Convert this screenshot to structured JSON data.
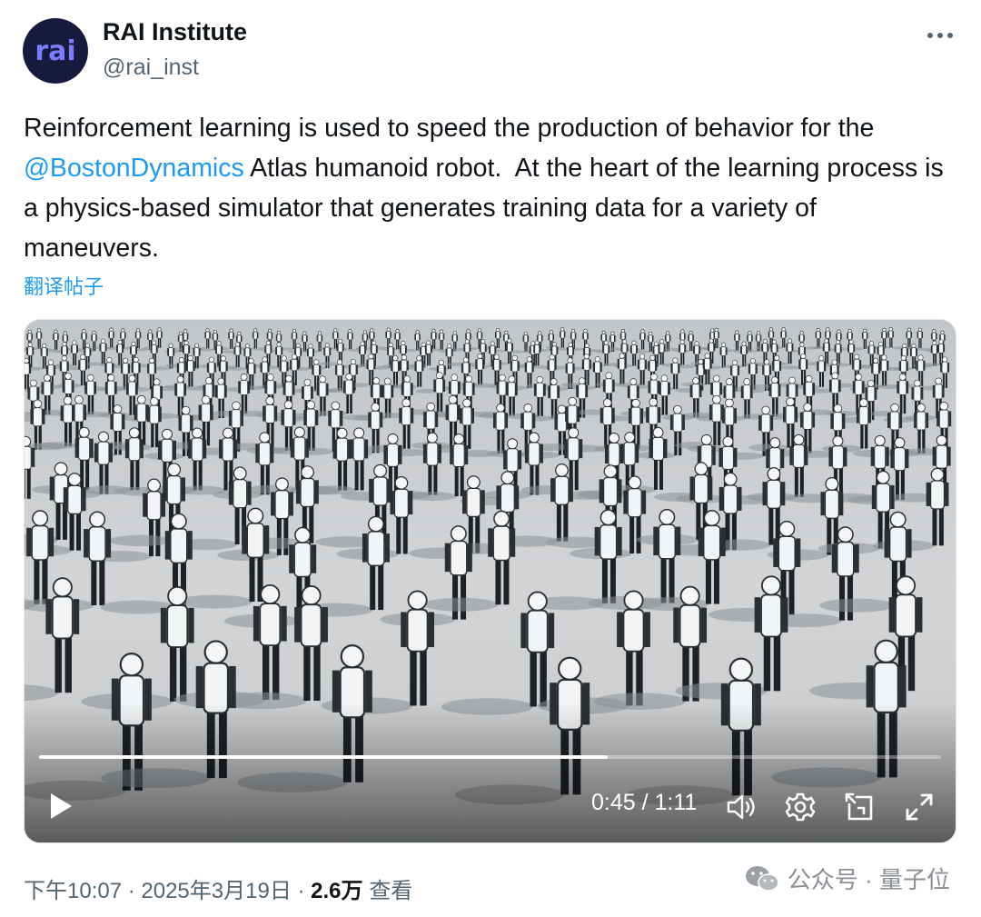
{
  "author": {
    "name": "RAI Institute",
    "handle": "@rai_inst",
    "avatar_text": "rai"
  },
  "tweet": {
    "text_before": "Reinforcement learning is used to speed the production of behavior for the ",
    "mention": "@BostonDynamics",
    "text_after": " Atlas humanoid robot.  At the heart of the learning process is a physics-based simulator that generates training data for a variety of maneuvers.",
    "translate_label": "翻译帖子"
  },
  "video": {
    "current_time": "0:45",
    "separator": " / ",
    "duration": "1:11",
    "progress_fraction": 0.63
  },
  "meta": {
    "time": "下午10:07",
    "dot": " · ",
    "date": "2025年3月19日",
    "views_count": "2.6万",
    "views_label": " 查看"
  },
  "watermark": {
    "text": "公众号 · 量子位"
  },
  "icons": {
    "more": "more-horizontal-icon",
    "play": "play-icon",
    "volume": "volume-icon",
    "settings": "settings-gear-icon",
    "pip": "picture-in-picture-icon",
    "fullscreen": "fullscreen-icon",
    "wechat": "wechat-icon"
  },
  "colors": {
    "link": "#1d9bf0",
    "text": "#0f1419",
    "muted": "#536471",
    "avatar_bg": "#161a3c",
    "avatar_fg": "#7b7cff"
  }
}
